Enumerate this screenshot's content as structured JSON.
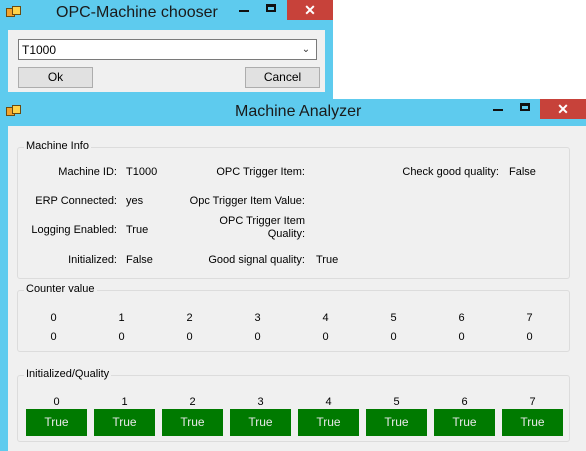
{
  "chooser": {
    "title": "OPC-Machine chooser",
    "combo_value": "T1000",
    "ok_label": "Ok",
    "cancel_label": "Cancel"
  },
  "analyzer": {
    "title": "Machine Analyzer",
    "machine_info": {
      "legend": "Machine Info",
      "machine_id_label": "Machine ID:",
      "machine_id_value": "T1000",
      "erp_label": "ERP Connected:",
      "erp_value": "yes",
      "logging_label": "Logging Enabled:",
      "logging_value": "True",
      "initialized_label": "Initialized:",
      "initialized_value": "False",
      "opc_trigger_item_label": "OPC Trigger Item:",
      "opc_trigger_item_value_label": "Opc Trigger Item Value:",
      "opc_trigger_item_quality_label_1": "OPC Trigger Item",
      "opc_trigger_item_quality_label_2": "Quality:",
      "good_signal_label": "Good signal quality:",
      "good_signal_value": "True",
      "check_good_label": "Check good quality:",
      "check_good_value": "False"
    },
    "counter": {
      "legend": "Counter value",
      "indices": [
        "0",
        "1",
        "2",
        "3",
        "4",
        "5",
        "6",
        "7"
      ],
      "values": [
        "0",
        "0",
        "0",
        "0",
        "0",
        "0",
        "0",
        "0"
      ]
    },
    "quality": {
      "legend": "Initialized/Quality",
      "indices": [
        "0",
        "1",
        "2",
        "3",
        "4",
        "5",
        "6",
        "7"
      ],
      "values": [
        "True",
        "True",
        "True",
        "True",
        "True",
        "True",
        "True",
        "True"
      ]
    }
  },
  "colors": {
    "title_bar": "#5ecbee",
    "close_button": "#c7423a",
    "status_green": "#007a00"
  },
  "icons": [
    "app-icon",
    "minimize-icon",
    "maximize-icon",
    "close-icon",
    "chevron-down-icon"
  ]
}
